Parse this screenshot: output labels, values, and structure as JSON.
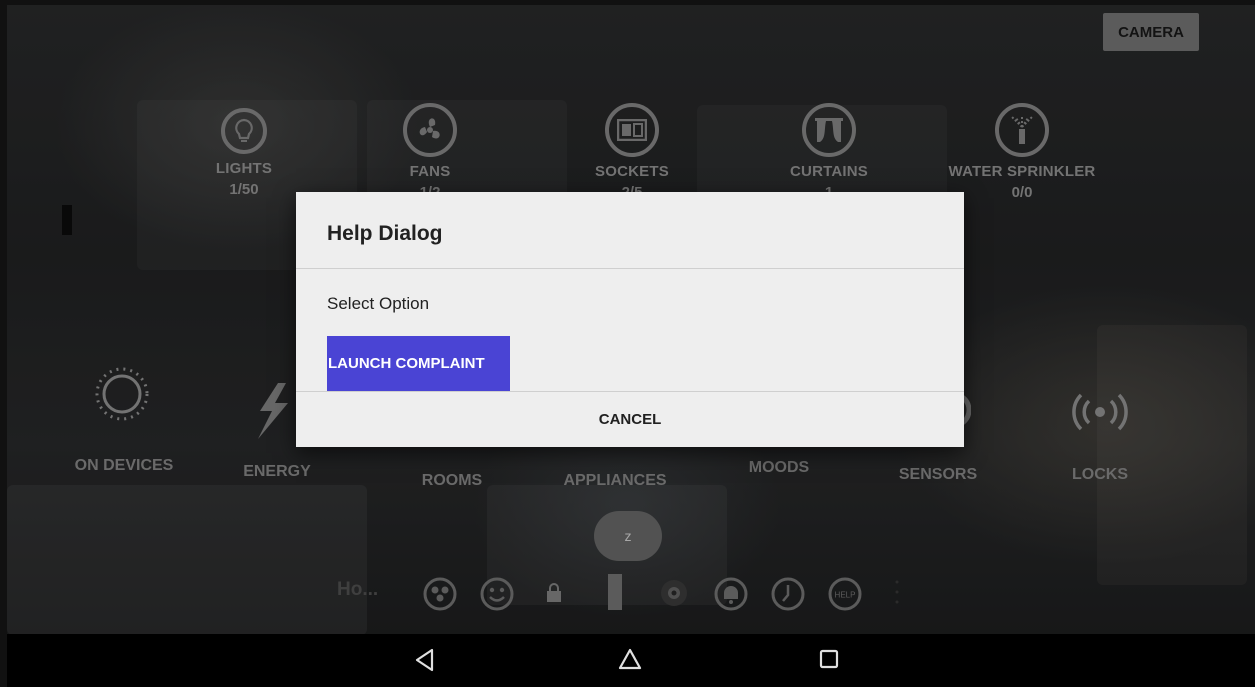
{
  "top": {
    "camera_label": "CAMERA"
  },
  "categories": [
    {
      "label": "LIGHTS",
      "count": "1/50",
      "icon": "bulb-icon"
    },
    {
      "label": "FANS",
      "count": "1/2",
      "icon": "fan-icon"
    },
    {
      "label": "SOCKETS",
      "count": "2/5",
      "icon": "socket-icon"
    },
    {
      "label": "CURTAINS",
      "count": "1",
      "icon": "curtain-icon"
    },
    {
      "label": "WATER SPRINKLER",
      "count": "0/0",
      "icon": "sprinkler-icon"
    }
  ],
  "sections": {
    "on_devices": "ON DEVICES",
    "energy": "ENERGY",
    "rooms": "ROOMS",
    "appliances": "APPLIANCES",
    "moods": "MOODS",
    "sensors": "SENSORS",
    "locks": "LOCKS"
  },
  "z_button": "z",
  "bottom": {
    "home_text": "Ho...",
    "help_icon_text": "HELP"
  },
  "dialog": {
    "title": "Help Dialog",
    "message": "Select Option",
    "launch_label": "LAUNCH COMPLAINT",
    "cancel_label": "CANCEL"
  },
  "colors": {
    "accent": "#4a44d4",
    "dialog_bg": "#eeeeee",
    "navbar": "#000000"
  }
}
